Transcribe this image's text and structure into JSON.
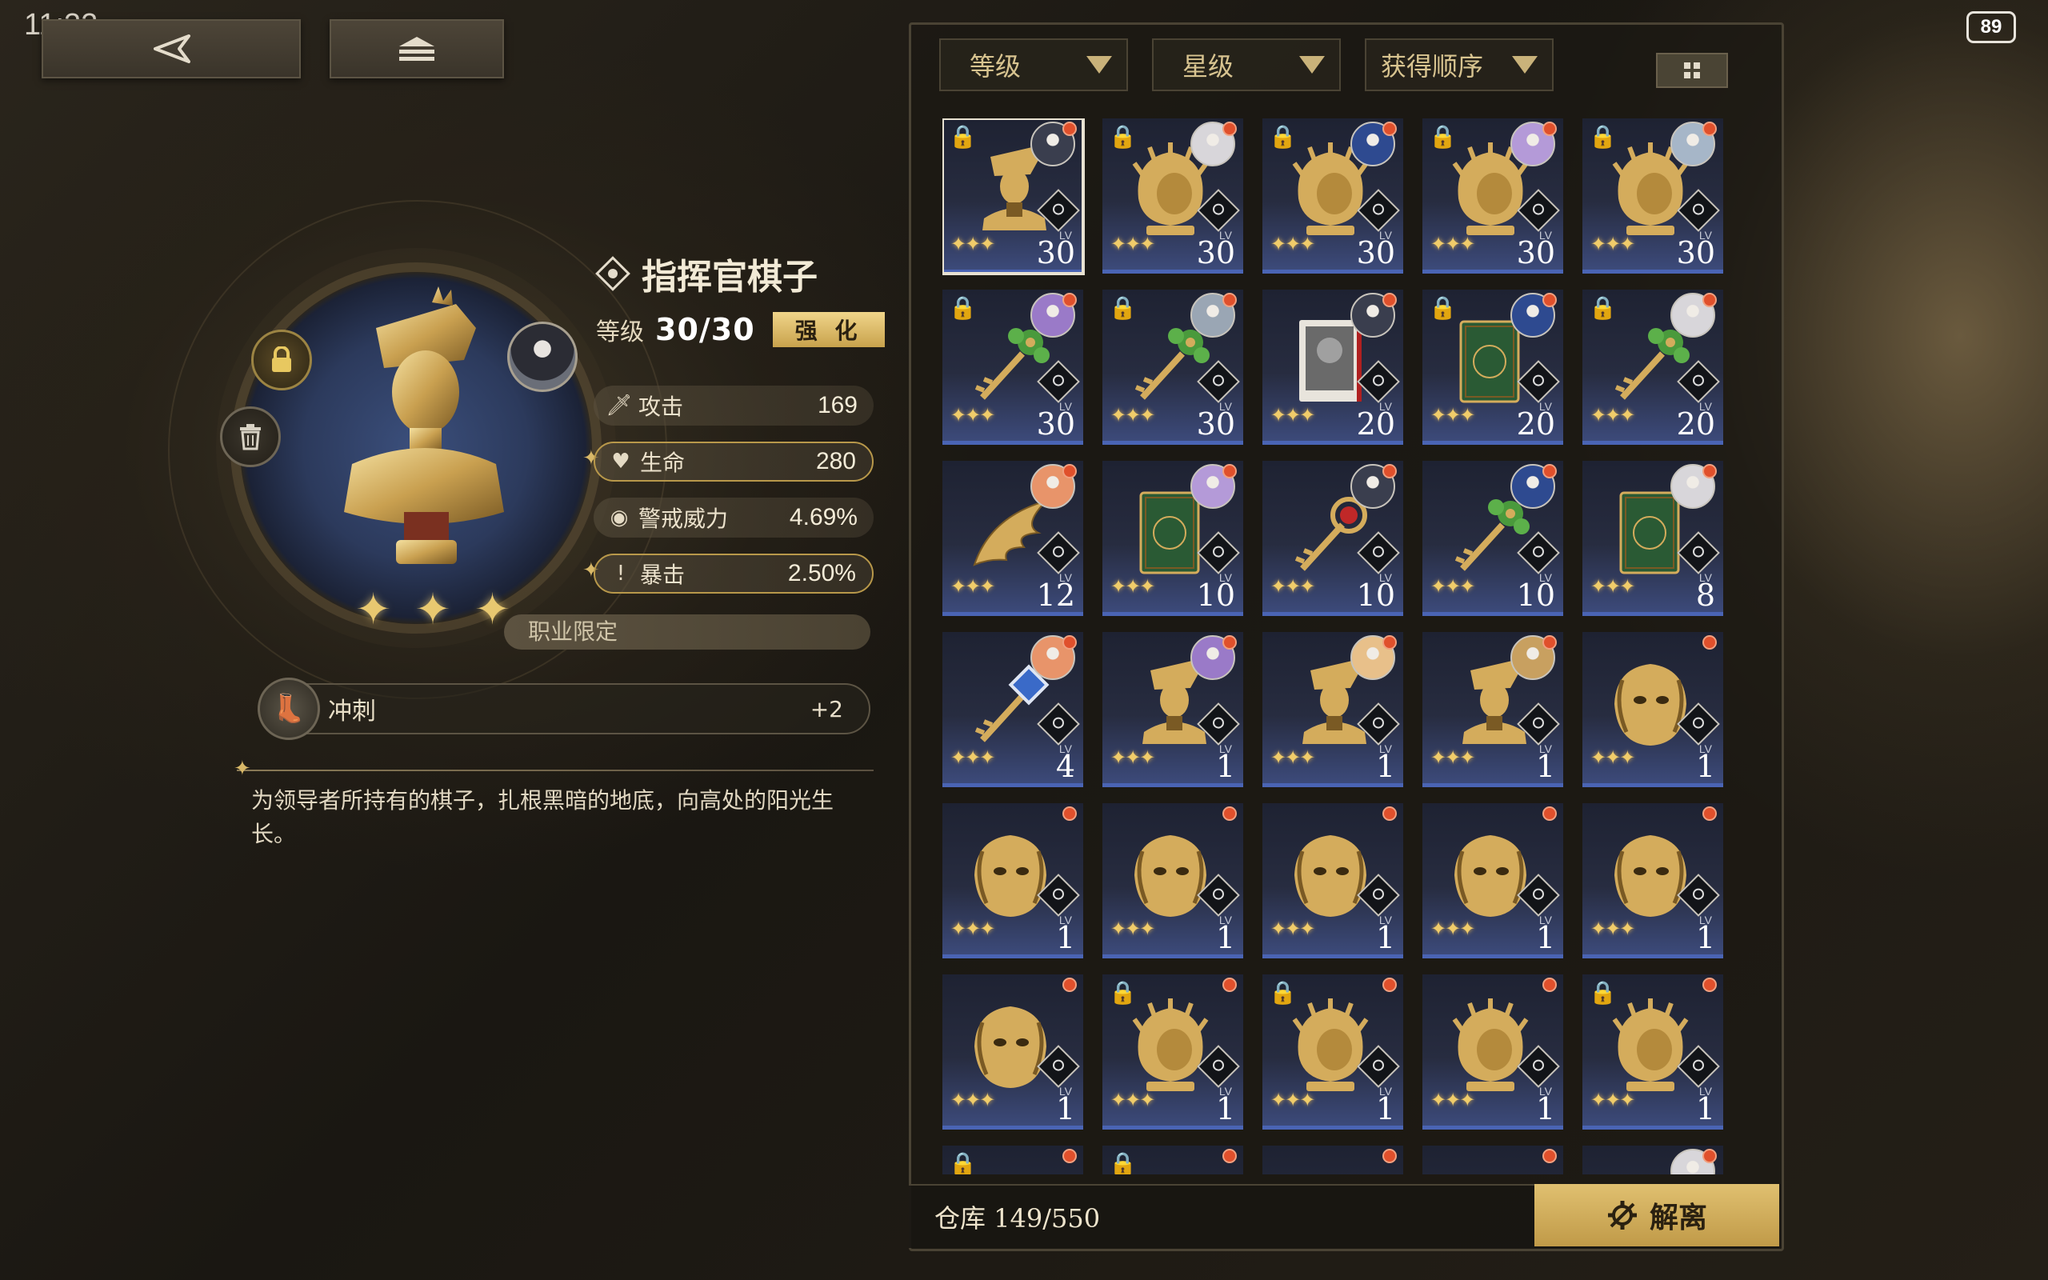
{
  "status": {
    "time": "11:32",
    "battery": "89"
  },
  "detail": {
    "name": "指挥官棋子",
    "level_label": "等级",
    "level_value": "30/30",
    "enhance_label": "强 化",
    "stats": [
      {
        "label": "攻击",
        "value": "169",
        "icon": "sword-icon",
        "highlighted": false
      },
      {
        "label": "生命",
        "value": "280",
        "icon": "heart-icon",
        "highlighted": true
      },
      {
        "label": "警戒威力",
        "value": "4.69%",
        "icon": "eye-icon",
        "highlighted": false
      },
      {
        "label": "暴击",
        "value": "2.50%",
        "icon": "exclaim-icon",
        "highlighted": true
      }
    ],
    "class_limit": "职业限定",
    "skill": {
      "name": "冲刺",
      "value": "+2",
      "icon": "boot-icon"
    },
    "description": "为领导者所持有的棋子，扎根黑暗的地底，向高处的阳光生长。",
    "star_count": 3
  },
  "filters": [
    {
      "label": "等级"
    },
    {
      "label": "星级"
    },
    {
      "label": "获得顺序"
    }
  ],
  "inventory": {
    "storage_label": "仓库 149/550",
    "dismantle_label": "解离",
    "lv_tag": "LV",
    "items": [
      {
        "type": "bust",
        "level": "30",
        "locked": true,
        "avatar": "#3a3e4e",
        "selected": true
      },
      {
        "type": "lion",
        "level": "30",
        "locked": true,
        "avatar": "#d8d6da"
      },
      {
        "type": "lion",
        "level": "30",
        "locked": true,
        "avatar": "#2e4a90"
      },
      {
        "type": "lion",
        "level": "30",
        "locked": true,
        "avatar": "#b49ad8"
      },
      {
        "type": "lion",
        "level": "30",
        "locked": true,
        "avatar": "#a6b6c8"
      },
      {
        "type": "key-green",
        "level": "30",
        "locked": true,
        "avatar": "#9a7ac8"
      },
      {
        "type": "key-green",
        "level": "30",
        "locked": true,
        "avatar": "#9aa6b4"
      },
      {
        "type": "photo",
        "level": "20",
        "locked": false,
        "avatar": "#3a3e4e"
      },
      {
        "type": "book",
        "level": "20",
        "locked": true,
        "avatar": "#2e4a90"
      },
      {
        "type": "key-green",
        "level": "20",
        "locked": true,
        "avatar": "#d8d6da"
      },
      {
        "type": "wing",
        "level": "12",
        "locked": false,
        "avatar": "#e8946a"
      },
      {
        "type": "book",
        "level": "10",
        "locked": false,
        "avatar": "#b49ad8"
      },
      {
        "type": "key-red",
        "level": "10",
        "locked": false,
        "avatar": "#3a3e4e"
      },
      {
        "type": "key-green",
        "level": "10",
        "locked": false,
        "avatar": "#2e4a90"
      },
      {
        "type": "book",
        "level": "8",
        "locked": false,
        "avatar": "#d8d6da"
      },
      {
        "type": "key-blue",
        "level": "4",
        "locked": false,
        "avatar": "#e8946a"
      },
      {
        "type": "bust",
        "level": "1",
        "locked": false,
        "avatar": "#9a7ac8"
      },
      {
        "type": "bust",
        "level": "1",
        "locked": false,
        "avatar": "#e8c08a"
      },
      {
        "type": "bust",
        "level": "1",
        "locked": false,
        "avatar": "#c8a060"
      },
      {
        "type": "mask",
        "level": "1",
        "locked": false,
        "avatar": ""
      },
      {
        "type": "mask",
        "level": "1",
        "locked": false,
        "avatar": ""
      },
      {
        "type": "mask",
        "level": "1",
        "locked": false,
        "avatar": ""
      },
      {
        "type": "mask",
        "level": "1",
        "locked": false,
        "avatar": ""
      },
      {
        "type": "mask",
        "level": "1",
        "locked": false,
        "avatar": ""
      },
      {
        "type": "mask",
        "level": "1",
        "locked": false,
        "avatar": ""
      },
      {
        "type": "mask",
        "level": "1",
        "locked": false,
        "avatar": ""
      },
      {
        "type": "lion",
        "level": "1",
        "locked": true,
        "avatar": ""
      },
      {
        "type": "lion",
        "level": "1",
        "locked": true,
        "avatar": ""
      },
      {
        "type": "lion",
        "level": "1",
        "locked": false,
        "avatar": ""
      },
      {
        "type": "lion",
        "level": "1",
        "locked": true,
        "avatar": ""
      },
      {
        "type": "partial",
        "level": "",
        "locked": true,
        "avatar": ""
      },
      {
        "type": "partial",
        "level": "",
        "locked": true,
        "avatar": ""
      },
      {
        "type": "partial",
        "level": "",
        "locked": false,
        "avatar": ""
      },
      {
        "type": "partial",
        "level": "",
        "locked": false,
        "avatar": ""
      },
      {
        "type": "partial",
        "level": "",
        "locked": false,
        "avatar": "#d8d6da"
      }
    ]
  },
  "colors": {
    "accent_gold": "#d8b868",
    "card_blue": "#4a64b4",
    "new_dot": "#e0502c"
  }
}
